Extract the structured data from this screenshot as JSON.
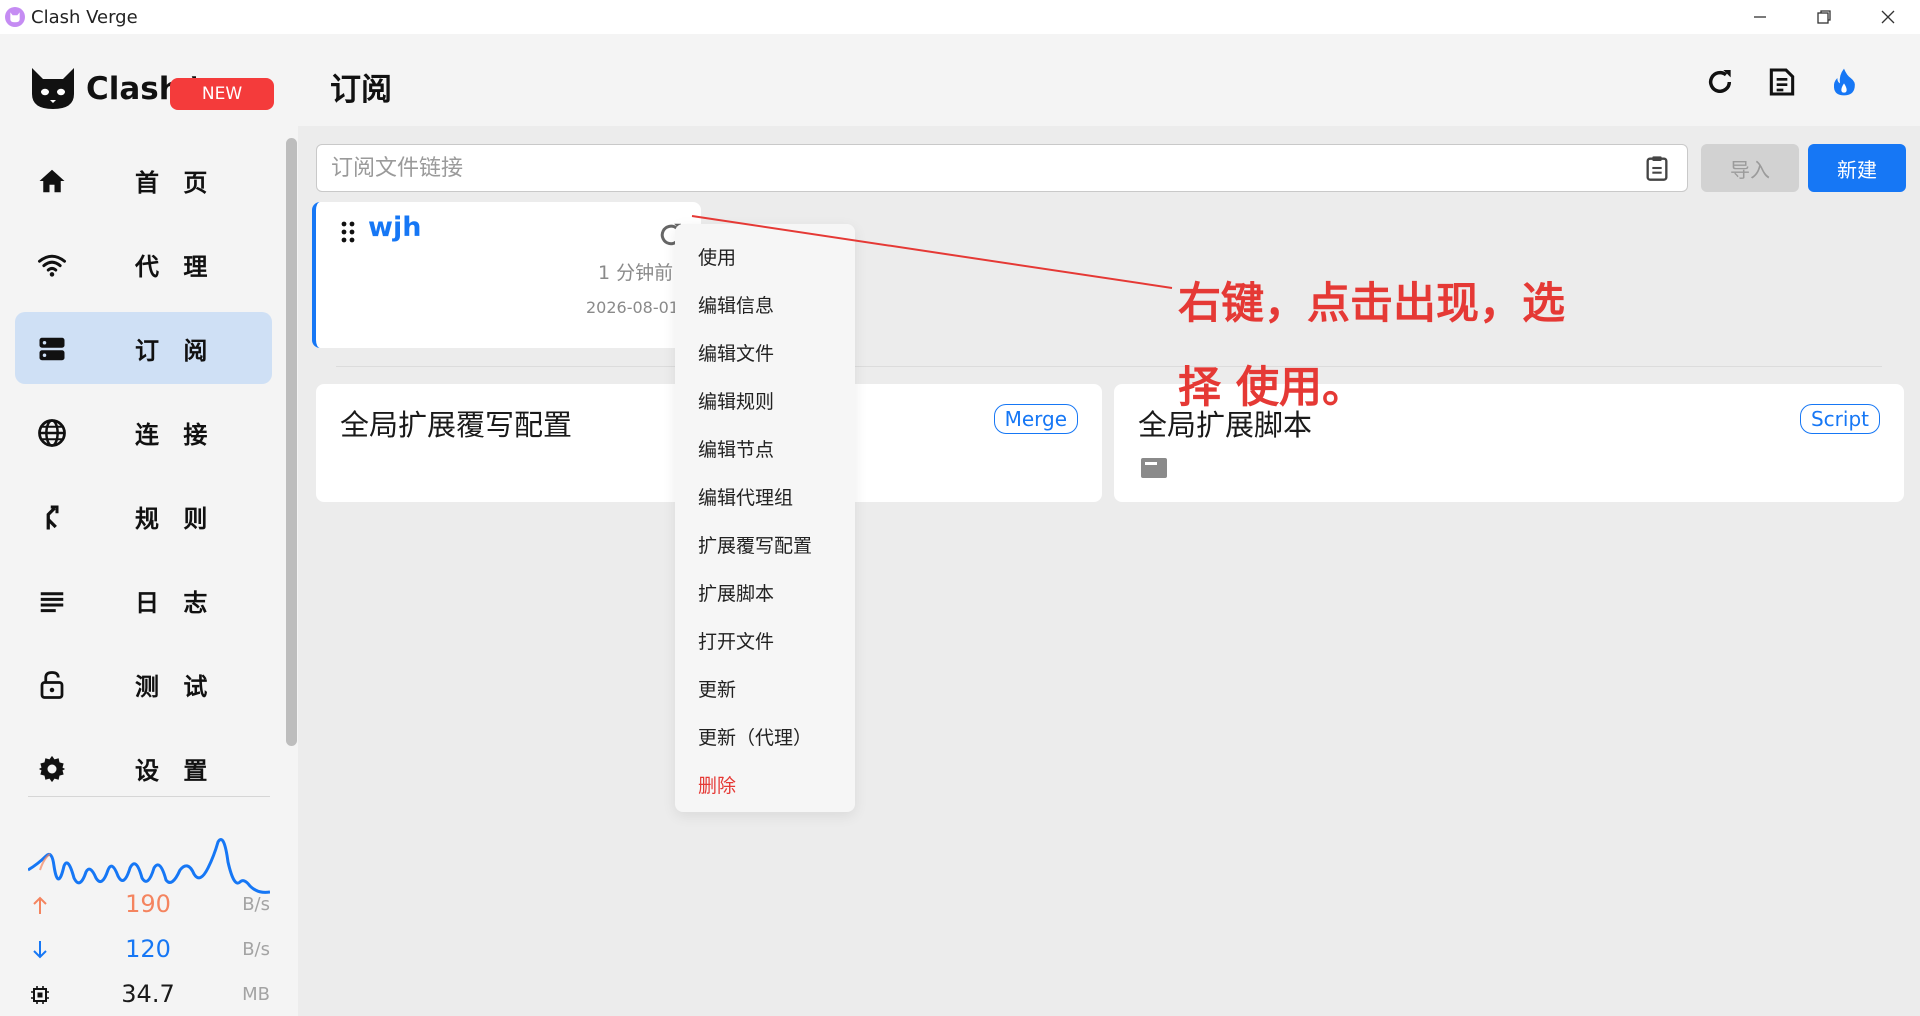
{
  "window": {
    "title": "Clash Verge",
    "controls": [
      "minimize-icon",
      "restore-icon",
      "close-icon"
    ]
  },
  "sidebar": {
    "logo_text": "Clash Verge",
    "new_badge": "NEW",
    "items": [
      {
        "label": "首 页",
        "icon": "home-icon",
        "active": false
      },
      {
        "label": "代 理",
        "icon": "wifi-icon",
        "active": false
      },
      {
        "label": "订 阅",
        "icon": "storage-icon",
        "active": true
      },
      {
        "label": "连 接",
        "icon": "globe-icon",
        "active": false
      },
      {
        "label": "规 则",
        "icon": "fork-icon",
        "active": false
      },
      {
        "label": "日 志",
        "icon": "lines-icon",
        "active": false
      },
      {
        "label": "测 试",
        "icon": "unlock-icon",
        "active": false
      },
      {
        "label": "设 置",
        "icon": "gear-icon",
        "active": false
      }
    ],
    "traffic": {
      "upload": {
        "value": "190",
        "unit": "B/s",
        "color": "#f4845f"
      },
      "download": {
        "value": "120",
        "unit": "B/s",
        "color": "#1677f5"
      },
      "memory": {
        "value": "34.7",
        "unit": "MB"
      }
    }
  },
  "header": {
    "title": "订阅",
    "icons": [
      "refresh-icon",
      "document-icon",
      "fire-icon"
    ]
  },
  "toolbar": {
    "url_placeholder": "订阅文件链接",
    "import_label": "导入",
    "new_label": "新建"
  },
  "profile": {
    "name": "wjh",
    "updated": "1 分钟前",
    "date": "2026-08-01"
  },
  "ext_cards": [
    {
      "title": "全局扩展覆写配置",
      "badge": "Merge"
    },
    {
      "title": "全局扩展脚本",
      "badge": "Script"
    }
  ],
  "context_menu": {
    "items": [
      "使用",
      "编辑信息",
      "编辑文件",
      "编辑规则",
      "编辑节点",
      "编辑代理组",
      "扩展覆写配置",
      "扩展脚本",
      "打开文件",
      "更新",
      "更新（代理）",
      "删除"
    ]
  },
  "annotation": {
    "line1": "右键，点击出现，选",
    "line2": "择 使用。",
    "color": "#e53935"
  },
  "colors": {
    "accent": "#1677f5",
    "active_nav": "#cfe0f5",
    "danger": "#e53935"
  }
}
